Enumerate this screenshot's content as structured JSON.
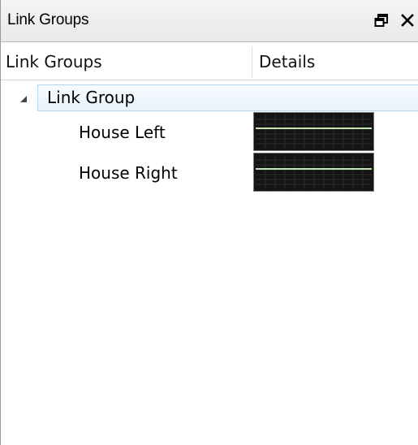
{
  "window": {
    "title": "Link Groups",
    "float_icon": "float-window-icon",
    "close_icon": "close-icon"
  },
  "columns": {
    "link_groups": "Link Groups",
    "details": "Details"
  },
  "tree": {
    "group": {
      "label": "Link Group",
      "expanded": true,
      "children": [
        {
          "label": "House Left",
          "details": "meter-preview"
        },
        {
          "label": "House Right",
          "details": "meter-preview"
        }
      ]
    }
  },
  "colors": {
    "selection_border": "#b8d4ea",
    "meter_background": "#141414",
    "meter_trace": "#bfe6b0"
  }
}
